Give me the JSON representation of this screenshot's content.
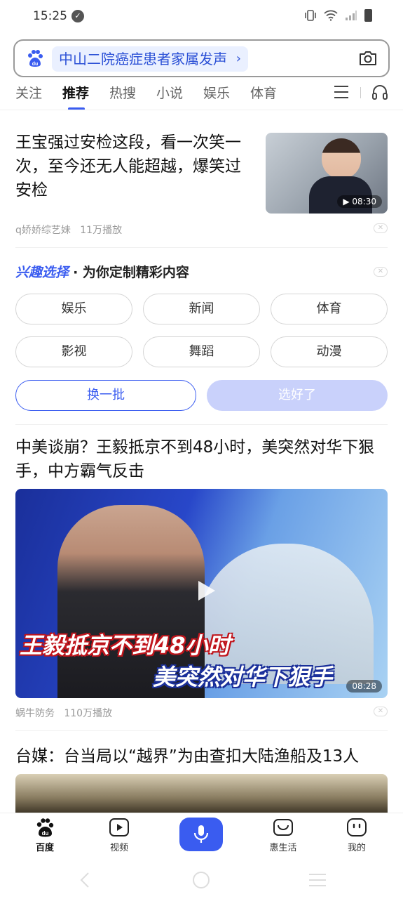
{
  "status_bar": {
    "time": "15:25"
  },
  "search": {
    "suggestion": "中山二院癌症患者家属发声"
  },
  "tabs": [
    {
      "label": "关注"
    },
    {
      "label": "推荐"
    },
    {
      "label": "热搜"
    },
    {
      "label": "小说"
    },
    {
      "label": "娱乐"
    },
    {
      "label": "体育"
    }
  ],
  "article1": {
    "title": "王宝强过安检这段，看一次笑一次，至今还无人能超越，爆笑过安检",
    "duration": "08:30",
    "source": "q娇娇综艺妹",
    "plays": "11万播放"
  },
  "interest": {
    "highlight": "兴趣选择",
    "rest": "· 为你定制精彩内容",
    "options": [
      "娱乐",
      "新闻",
      "体育",
      "影视",
      "舞蹈",
      "动漫"
    ],
    "refresh_label": "换一批",
    "done_label": "选好了"
  },
  "article2": {
    "title": "中美谈崩？王毅抵京不到48小时，美突然对华下狠手，中方霸气反击",
    "overlay_line1": "王毅抵京不到48小时",
    "overlay_line2": "美突然对华下狠手",
    "duration": "08:28",
    "source": "蜗牛防务",
    "plays": "110万播放"
  },
  "article3": {
    "title": "台媒：台当局以“越界”为由查扣大陆渔船及13人"
  },
  "bottom_nav": [
    {
      "label": "百度",
      "icon": "baidu-paw-icon"
    },
    {
      "label": "视频",
      "icon": "video-play-icon"
    },
    {
      "label": "",
      "icon": "microphone-icon"
    },
    {
      "label": "惠生活",
      "icon": "shopping-bag-icon"
    },
    {
      "label": "我的",
      "icon": "profile-face-icon"
    }
  ],
  "colors": {
    "accent": "#3a5cf0",
    "chip_bg": "#eaf0ff",
    "done_bg": "#c9d1fb"
  }
}
